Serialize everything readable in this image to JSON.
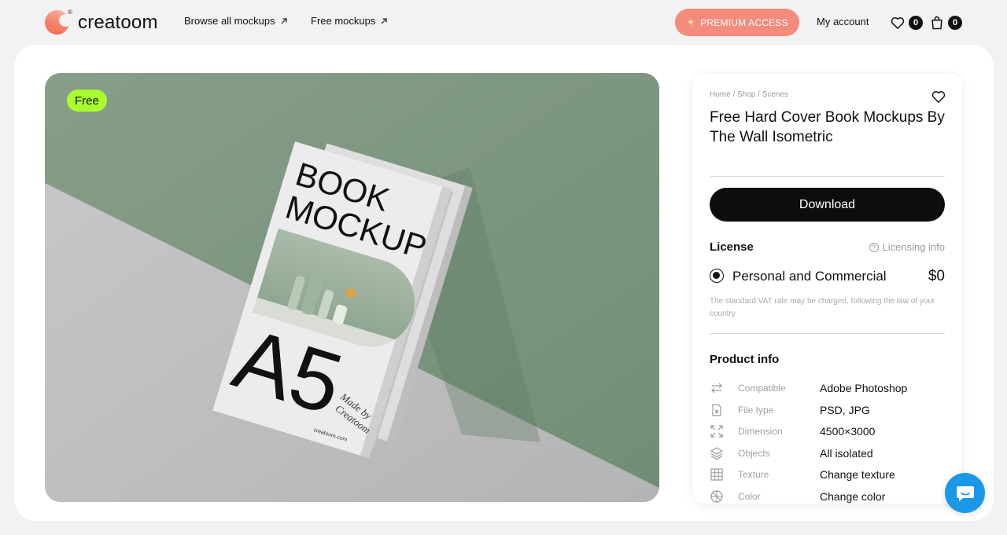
{
  "header": {
    "logo_text": "creatoom",
    "logo_reg": "®",
    "nav": [
      {
        "label": "Browse all mockups",
        "icon": "arrow-up-right-icon"
      },
      {
        "label": "Free mockups",
        "icon": "arrow-up-right-icon"
      }
    ],
    "premium_label": "PREMIUM ACCESS",
    "my_account_label": "My account",
    "wishlist_count": "0",
    "cart_count": "0"
  },
  "preview": {
    "badge": "Free",
    "book_title_line1": "BOOK",
    "book_title_line2": "MOCKUP",
    "book_size": "A5",
    "book_signature": "Made by Creatoom",
    "book_url": "creatoom.com"
  },
  "product": {
    "breadcrumb": "Home / Shop / Scenes",
    "title": "Free Hard Cover Book Mockups By The Wall Isometric",
    "download_label": "Download",
    "license_label": "License",
    "licensing_info_label": "Licensing info",
    "license_option": "Personal and Commercial",
    "license_price": "$0",
    "vat_note": "The standard VAT rate may be charged, following the law of your country",
    "product_info_title": "Product info",
    "info_rows": [
      {
        "icon": "swap-arrows-icon",
        "key": "Compatible",
        "value": "Adobe Photoshop"
      },
      {
        "icon": "file-icon",
        "key": "File type",
        "value": "PSD, JPG"
      },
      {
        "icon": "expand-icon",
        "key": "Dimension",
        "value": "4500×3000"
      },
      {
        "icon": "layers-icon",
        "key": "Objects",
        "value": "All isolated"
      },
      {
        "icon": "grid-icon",
        "key": "Texture",
        "value": "Change texture"
      },
      {
        "icon": "palette-icon",
        "key": "Color",
        "value": "Change color"
      }
    ]
  },
  "colors": {
    "accent_premium": "#f58b7c",
    "free_badge": "#a8ff2d",
    "download_bg": "#0d0d0d",
    "chat_bg": "#1a97e6",
    "wall": "#7f9a83"
  }
}
